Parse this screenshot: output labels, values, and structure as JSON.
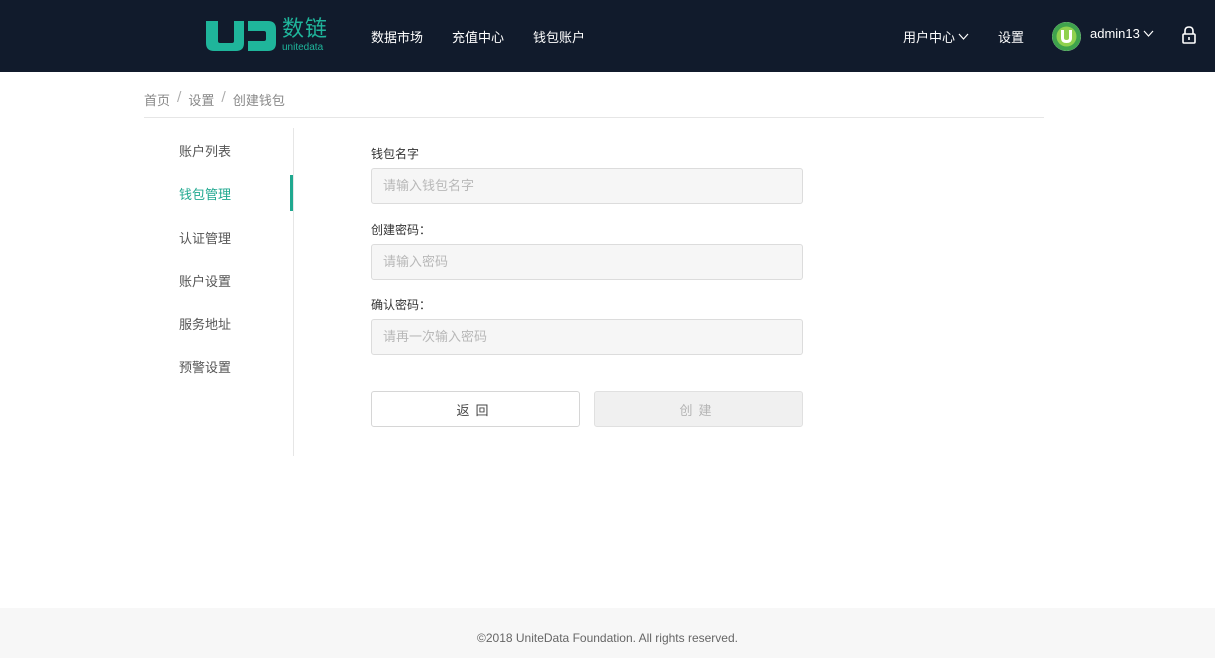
{
  "header": {
    "logo_cn": "数链",
    "logo_en": "unitedata",
    "nav": [
      "数据市场",
      "充值中心",
      "钱包账户"
    ],
    "user_center": "用户中心",
    "settings": "设置",
    "username": "admin13"
  },
  "breadcrumb": [
    "首页",
    "设置",
    "创建钱包"
  ],
  "sidebar": {
    "items": [
      "账户列表",
      "钱包管理",
      "认证管理",
      "账户设置",
      "服务地址",
      "预警设置"
    ],
    "active_index": 1
  },
  "form": {
    "wallet_name_label": "钱包名字",
    "wallet_name_placeholder": "请输入钱包名字",
    "password_label": "创建密码：",
    "password_placeholder": "请输入密码",
    "confirm_label": "确认密码：",
    "confirm_placeholder": "请再一次输入密码",
    "back_button": "返回",
    "create_button": "创建"
  },
  "footer": {
    "copyright": "©2018 UniteData Foundation. All rights reserved."
  },
  "colors": {
    "header_bg": "#111b2c",
    "accent": "#1fa88f"
  }
}
